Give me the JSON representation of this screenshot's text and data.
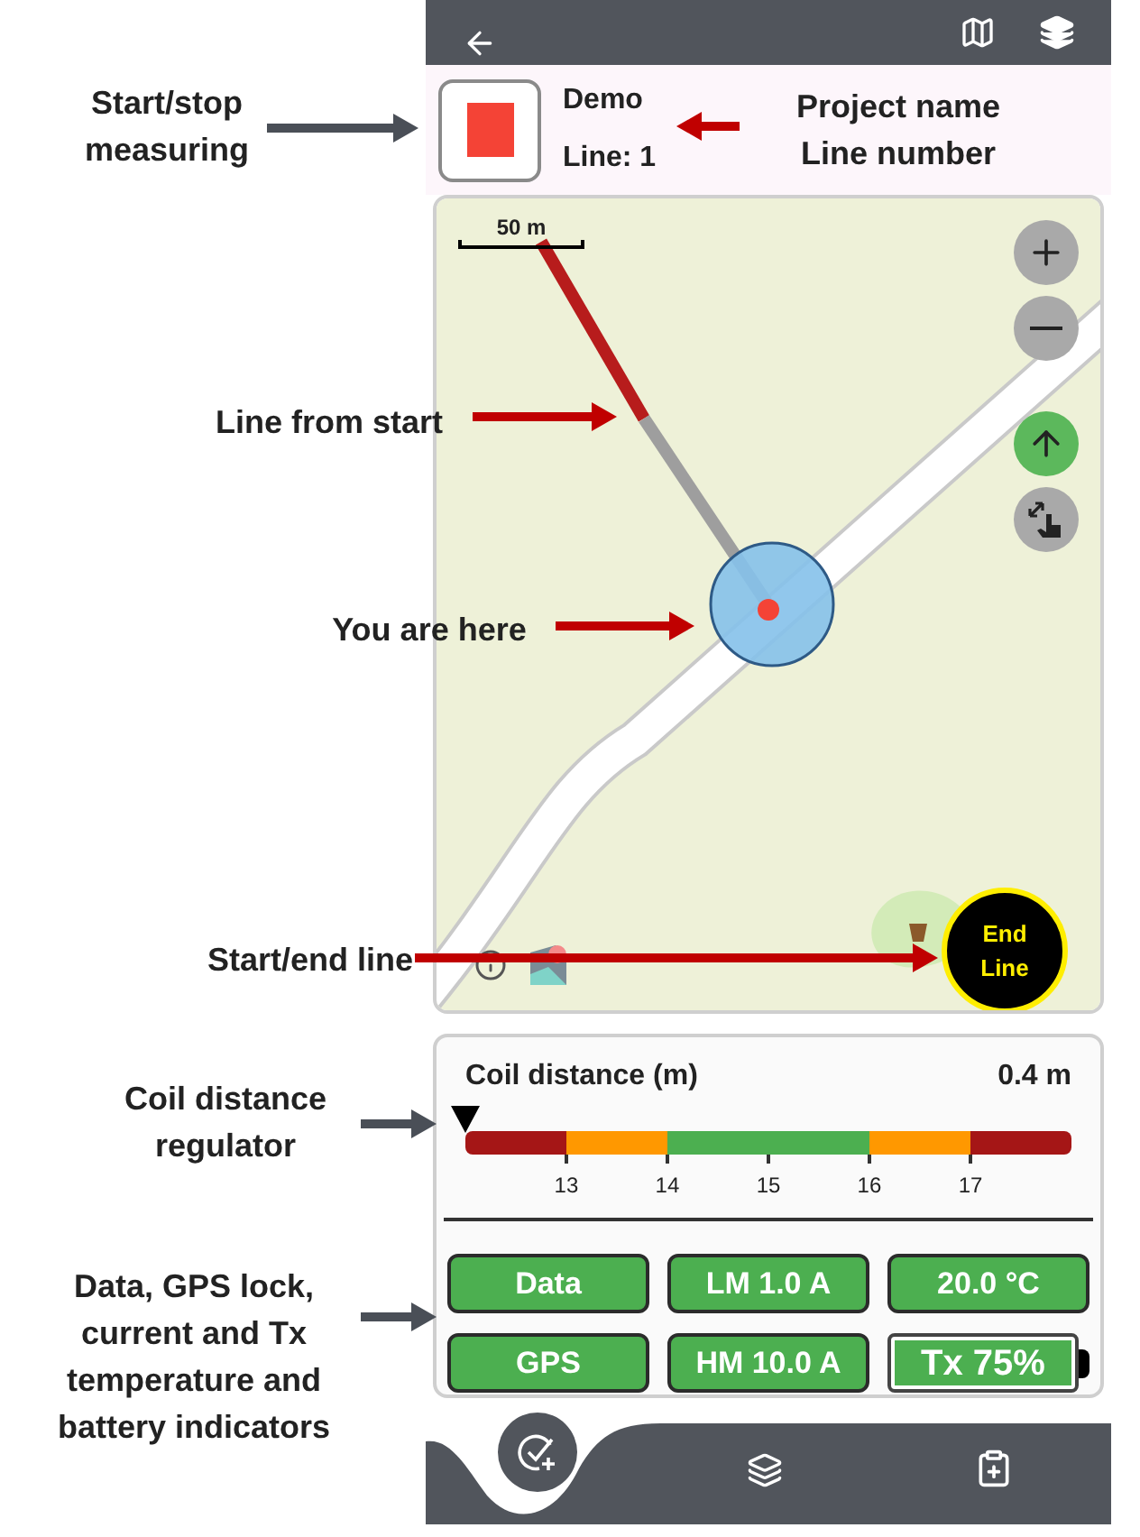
{
  "header": {
    "project": "Demo",
    "line": "Line: 1",
    "measuring": true
  },
  "map": {
    "scale": "50 m",
    "end_button": "End Line",
    "north_up": true
  },
  "coil": {
    "title": "Coil distance (m)",
    "reading": "0.4 m",
    "level": 0,
    "ticks": [
      "13",
      "14",
      "15",
      "16",
      "17"
    ]
  },
  "indicators": [
    {
      "label": "Data",
      "kind": "pill"
    },
    {
      "label": "LM 1.0 A",
      "kind": "pill"
    },
    {
      "label": "20.0 °C",
      "kind": "pill"
    },
    {
      "label": "GPS",
      "kind": "pill"
    },
    {
      "label": "HM 10.0 A",
      "kind": "pill"
    },
    {
      "label": "Tx 75%",
      "kind": "battery"
    }
  ],
  "annotations": [
    {
      "lines": [
        "Start/stop",
        "measuring"
      ],
      "color": "#4a4f57"
    },
    {
      "lines": [
        "Project name",
        "Line number"
      ],
      "color": "#c00000"
    },
    {
      "lines": [
        "Line from start"
      ],
      "color": "#c00000"
    },
    {
      "lines": [
        "You are here"
      ],
      "color": "#c00000"
    },
    {
      "lines": [
        "Start/end line"
      ],
      "color": "#c00000"
    },
    {
      "lines": [
        "Coil distance",
        "regulator"
      ],
      "color": "#4a4f57"
    },
    {
      "lines": [
        "Data, GPS lock,",
        "current and Tx",
        "temperature and",
        "battery indicators"
      ],
      "color": "#4a4f57"
    }
  ]
}
